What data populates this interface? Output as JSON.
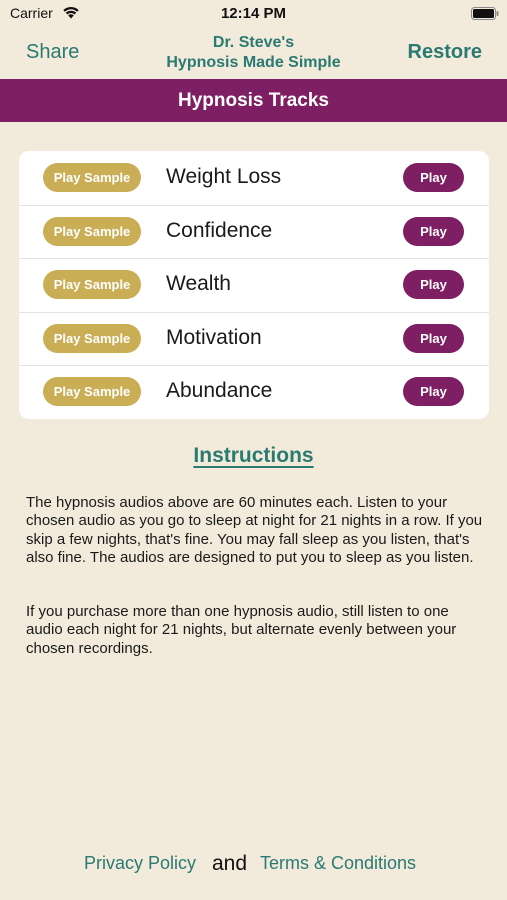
{
  "status_bar": {
    "carrier": "Carrier",
    "time": "12:14 PM",
    "wifi_icon": "wifi-icon",
    "battery_icon": "battery-icon"
  },
  "nav": {
    "share_label": "Share",
    "title_line1": "Dr. Steve's",
    "title_line2": "Hypnosis Made Simple",
    "restore_label": "Restore"
  },
  "section_header": "Hypnosis Tracks",
  "tracks": [
    {
      "sample_label": "Play Sample",
      "name": "Weight Loss",
      "play_label": "Play"
    },
    {
      "sample_label": "Play Sample",
      "name": "Confidence",
      "play_label": "Play"
    },
    {
      "sample_label": "Play Sample",
      "name": "Wealth",
      "play_label": "Play"
    },
    {
      "sample_label": "Play Sample",
      "name": "Motivation",
      "play_label": "Play"
    },
    {
      "sample_label": "Play Sample",
      "name": "Abundance",
      "play_label": "Play"
    }
  ],
  "instructions": {
    "heading": "Instructions",
    "paragraph1": "The hypnosis audios above are 60 minutes each. Listen to your chosen audio as you go to sleep at night for 21 nights in a row. If you skip a few nights, that's fine. You may fall sleep as you listen, that's also fine. The audios are designed to put you to sleep as you listen.",
    "paragraph2": "If you purchase more than one hypnosis audio, still listen to one audio each night for 21 nights, but alternate evenly between your chosen recordings."
  },
  "footer": {
    "privacy_label": "Privacy Policy",
    "and_label": "and",
    "terms_label": "Terms & Conditions"
  },
  "colors": {
    "background": "#f2ebdc",
    "accent_teal": "#2a7a72",
    "header_purple": "#7d1f62",
    "sample_gold": "#c9ae55"
  }
}
